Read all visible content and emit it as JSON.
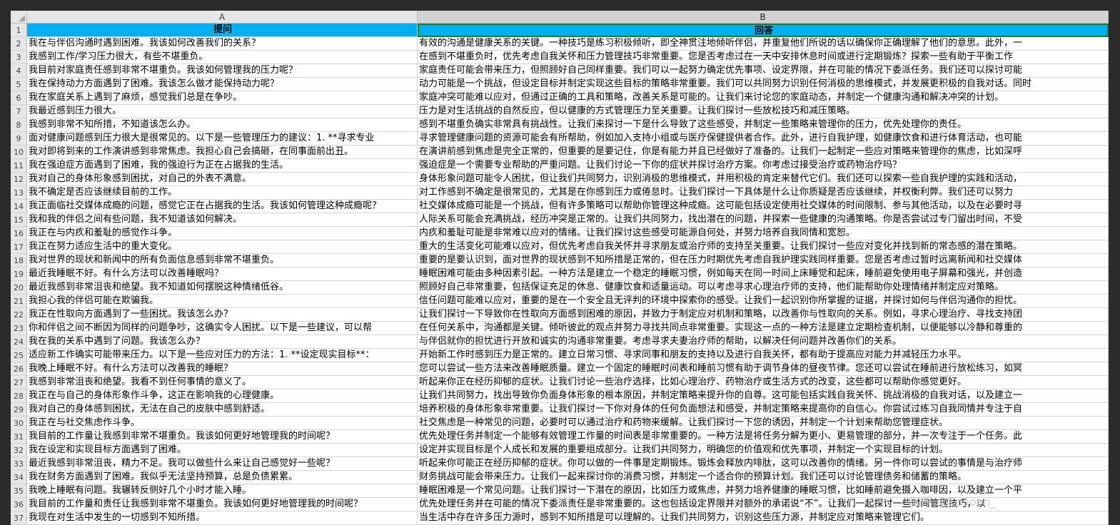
{
  "columns": [
    "A",
    "B"
  ],
  "header": {
    "row": "1",
    "a": "提问",
    "b": "回答"
  },
  "rows": [
    {
      "n": "2",
      "a": "我在与伴侣沟通时遇到困难。我该如何改善我们的关系？",
      "b": "有效的沟通是健康关系的关键。一种技巧是练习积极倾听，即全神贯注地倾听伴侣，并重复他们所说的话以确保你正确理解了他们的意思。此外，一"
    },
    {
      "n": "3",
      "a": "我感到工作/学习压力很大，有些不堪重负。",
      "b": "在感到不堪重负时，优先考虑自我关怀和压力管理技巧非常重要。您是否考虑过在一天中安排休息时间或进行定期锻炼？探索一些有助于平衡工作"
    },
    {
      "n": "4",
      "a": "我目前对家庭责任感到非常不堪重负。我该如何管理我的压力呢？",
      "b": "家庭责任可能会带来压力，但照顾好自己同样重要。我们可以一起努力确定优先事项、设定界限，并在可能的情况下委派任务。我们还可以探讨可能"
    },
    {
      "n": "5",
      "a": "我在保持动力方面遇到了困难。我该怎么做才能保持动力呢？",
      "b": "动力可能是一个挑战，但设定目标并制定实现这些目标的策略非常重要。我们可以共同努力识别任何消极的思维模式，并发展更积极的自我对话。同时"
    },
    {
      "n": "6",
      "a": "我在家庭关系上遇到了麻烦，感觉我们总是在争吵。",
      "b": "家庭冲突可能难以应对，但通过正确的工具和策略，改善关系是可能的。让我们来讨论您的家庭动态，并制定一个健康沟通和解决冲突的计划。"
    },
    {
      "n": "7",
      "a": "我最近感到压力很大。",
      "b": "压力是对生活挑战的自然反应，但以健康的方式管理压力至关重要。让我们探讨一些放松技巧和减压策略。"
    },
    {
      "n": "8",
      "a": "我感到非常不知所措，不知道该怎么办。",
      "b": "感到不堪重负确实非常具有挑战性。让我们来探讨一下是什么导致了这些感受，并制定一些策略来管理你的压力，优先处理你的责任。"
    },
    {
      "n": "9",
      "a": "面对健康问题感到压力很大是很常见的。以下是一些管理压力的建议：1. **寻求专业",
      "b": "寻求管理健康问题的资源可能会有所帮助，例如加入支持小组或与医疗保健提供者合作。此外，进行自我护理，如健康饮食和进行体育活动，也可能"
    },
    {
      "n": "10",
      "a": "我对即将到来的工作演讲感到非常焦虑。我担心自己会搞砸，在同事面前出丑。",
      "b": "在演讲前感到焦虑是完全正常的，但重要的是要记住，你是有能力并且已经做好了准备的。让我们一起制定一些应对策略来管理你的焦虑，比如深呼"
    },
    {
      "n": "11",
      "a": "我在强迫症方面遇到了困难，我的强迫行为正在占据我的生活。",
      "b": "强迫症是一个需要专业帮助的严重问题。让我们讨论一下你的症状并探讨治疗方案。你考虑过接受治疗或药物治疗吗？"
    },
    {
      "n": "12",
      "a": "我对自己的身体形象感到困扰，对自己的外表不满意。",
      "b": "身体形象问题可能令人困扰，但让我们共同努力，识别消极的思维模式，并用积极的肯定来替代它们。我们还可以探索一些自我护理的实践和活动，"
    },
    {
      "n": "13",
      "a": "我不确定是否应该继续目前的工作。",
      "b": "对工作感到不确定是很常见的，尤其是在你感到压力或倦怠时。让我们探讨一下具体是什么让你质疑是否应该继续，并权衡利弊。我们还可以努力"
    },
    {
      "n": "14",
      "a": "我正面临社交媒体成瘾的问题，感觉它正在占据我的生活。我该如何管理这种成瘾呢？",
      "b": "社交媒体成瘾可能是一个挑战，但有许多策略可以帮助你管理这种成瘾。这可能包括设定使用社交媒体的时间限制、参与其他活动，以及在必要时寻"
    },
    {
      "n": "15",
      "a": "我和我的伴侣之间有些问题，我不知道该如何解决。",
      "b": "人际关系可能会充满挑战，经历冲突是正常的。让我们共同努力，找出潜在的问题，并探索一些健康的沟通策略。你是否尝试过专门留出时间，不受"
    },
    {
      "n": "16",
      "a": "我正在与内疚和羞耻的感觉作斗争。",
      "b": "内疚和羞耻可能是非常难以应对的情绪。让我们探讨这些感受可能源自何处，并努力培养自我同情和宽恕。"
    },
    {
      "n": "17",
      "a": "我正在努力适应生活中的重大变化。",
      "b": "重大的生活变化可能难以应对，但优先考虑自我关怀并寻求朋友或治疗师的支持至关重要。让我们探讨一些应对变化并找到新的常态感的潜在策略。"
    },
    {
      "n": "18",
      "a": "我对世界的现状和新闻中的所有负面信息感到非常不堪重负。",
      "b": "重要的是要认识到，面对世界的现状感到不知所措是正常的，但在压力时期优先考虑自我护理实践同样重要。您是否考虑过暂时远离新闻和社交媒体"
    },
    {
      "n": "19",
      "a": "最近我睡眠不好。有什么方法可以改善睡眠吗？",
      "b": "睡眠困难可能由多种因素引起。一种方法是建立一个稳定的睡眠习惯，例如每天在同一时间上床睡觉和起床，睡前避免使用电子屏幕和强光，并创造"
    },
    {
      "n": "20",
      "a": "最近我感到非常沮丧和绝望。我不知道如何摆脱这种情绪低谷。",
      "b": "照顾好自己非常重要，包括保证充足的休息、健康饮食和适量运动。可以考虑寻求心理治疗师的支持，他们能帮助你处理情绪并制定应对策略。"
    },
    {
      "n": "21",
      "a": "我担心我的伴侣可能在欺骗我。",
      "b": "信任问题可能难以应对，重要的是在一个安全且无评判的环境中探索你的感受。让我们一起识别你所掌握的证据，并探讨如何与伴侣沟通你的担忧。"
    },
    {
      "n": "22",
      "a": "我正在性取向方面遇到了一些困扰。我该怎么办？",
      "b": "让我们探讨一下导致你在性取向方面感到困难的原因，并致力于制定应对机制和策略，以改善你与性取向的关系。例如，寻求心理治疗、寻找支持团"
    },
    {
      "n": "23",
      "a": "你和伴侣之间不断因为同样的问题争吵，这确实令人困扰。以下是一些建议，可以帮",
      "b": "在任何关系中，沟通都是关键。倾听彼此的观点并努力寻找共同点非常重要。实现这一点的一种方法是建立定期检查机制，以便能够以冷静和尊重的"
    },
    {
      "n": "24",
      "a": "我在我的关系中遇到了问题。我该怎么办？",
      "b": "与伴侣就你的担忧进行开放和诚实的沟通非常重要。考虑寻求夫妻治疗师的帮助，以解决任何问题并改善你们的关系。"
    },
    {
      "n": "25",
      "a": "适应新工作确实可能带来压力。以下是一些应对压力的方法：1. **设定现实目标**：",
      "b": "开始新工作时感到压力是正常的。建立日常习惯、寻求同事和朋友的支持以及进行自我关怀，都有助于提高应对能力并减轻压力水平。"
    },
    {
      "n": "26",
      "a": "我晚上睡眠不好。有什么方法可以改善我的睡眠？",
      "b": "您可以尝试一些方法来改善睡眠质量。建立一个固定的睡眠时间表和睡前习惯有助于调节身体的昼夜节律。您还可以尝试在睡前进行放松练习，如冥"
    },
    {
      "n": "27",
      "a": "我感到非常沮丧和绝望。我看不到任何事情的意义了。",
      "b": "听起来你正在经历抑郁的症状。让我们讨论一些治疗选择，比如心理治疗、药物治疗或生活方式的改变，这些都可以帮助你感觉更好。"
    },
    {
      "n": "28",
      "a": "我正在与自己的身体形象作斗争，这正在影响我的心理健康。",
      "b": "让我们共同努力，找出导致你负面身体形象的根本原因，并制定策略来提升你的自尊。这可能包括实践自我关怀、挑战消极的自我对话，以及建立一"
    },
    {
      "n": "29",
      "a": "我对自己的身体感到困扰，无法在自己的皮肤中感到舒适。",
      "b": "培养积极的身体形象非常重要。让我们探讨一下你对身体的任何负面想法和感受，并制定策略来提高你的自信心。你尝试过练习自我同情并专注于自"
    },
    {
      "n": "30",
      "a": "我正在与社交焦虑作斗争。",
      "b": "社交焦虑是一种常见的问题，必要时可以通过治疗和药物来缓解。让我们探讨一下您的诱因，并制定一个计划来帮助您管理症状。"
    },
    {
      "n": "31",
      "a": "我目前的工作量让我感到非常不堪重负。我该如何更好地管理我的时间呢？",
      "b": "优先处理任务并制定一个能够有效管理工作量的时间表是非常重要的。一种方法是将任务分解为更小、更易管理的部分，并一次专注于一个任务。此"
    },
    {
      "n": "32",
      "a": "我在设定和实现目标方面遇到了困难。",
      "b": "设定并实现目标是个人成长和发展的重要组成部分。让我们共同努力，明确您的价值观和优先事项，并制定一个实现目标的计划。"
    },
    {
      "n": "33",
      "a": "最近我感到非常沮丧，精力不足。我可以做些什么来让自己感觉好一些呢？",
      "b": "听起来你可能正在经历抑郁的症状。你可以做的一件事是定期锻炼。锻炼会释放内啡肽，这可以改善你的情绪。另一件你可以尝试的事情是与治疗师"
    },
    {
      "n": "34",
      "a": "我在财务方面遇到了困难。我似乎无法坚持预算，总是负债累累。",
      "b": "财务挑战可能会带来压力。让我们一起来探讨你的消费习惯，并制定一个适合你的预算计划。我们还可以讨论管理债务和储蓄的策略。"
    },
    {
      "n": "35",
      "a": "我晚上睡眠有问题。我辗转反侧好几个小时才能入睡。",
      "b": "睡眠困难是一个常见问题。让我们探讨一下潜在的原因，比如压力或焦虑，并努力培养健康的睡眠习惯，比如睡前避免摄入咖啡因，以及建立一个平"
    },
    {
      "n": "36",
      "a": "我目前的工作量和责任让我感到非常不堪重负。我该如何更好地管理我的时间呢？",
      "b": "优先处理任务并在可能的情况下委派责任是非常重要的。这也包括设定界限并对额外的承诺说“不”。让我们一起探讨一些时间管理技巧，以"
    },
    {
      "n": "37",
      "a": "我现在对生活中发生的一切感到不知所措。",
      "b": "当生活中存在许多压力源时，感到不知所措是可以理解的。让我们共同努力，识别这些压力源，并制定应对策略来管理它们。"
    }
  ],
  "watermark": "知乎 @Eoooon_"
}
